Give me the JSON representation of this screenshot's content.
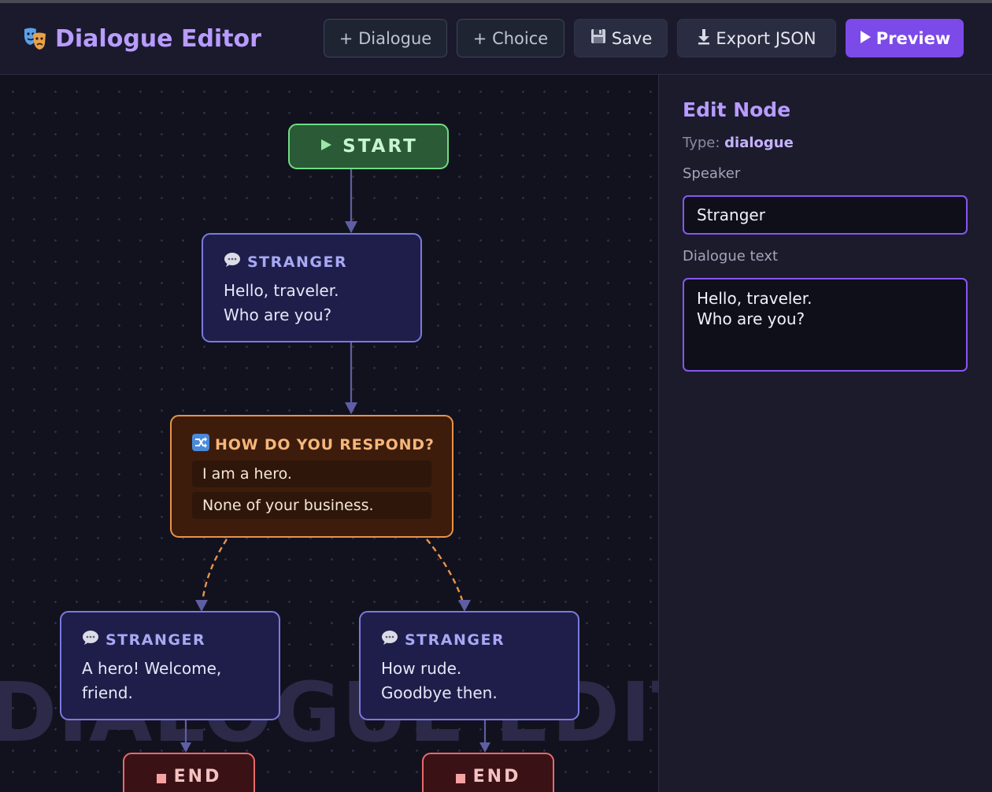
{
  "header": {
    "title": "Dialogue Editor",
    "buttons": {
      "add_dialogue": "+ Dialogue",
      "add_choice": "+ Choice",
      "save": "Save",
      "export": "Export JSON",
      "preview": "Preview"
    }
  },
  "canvas": {
    "watermark": "DIALOGUE EDITOR",
    "start_label": "START",
    "nodes": [
      {
        "speaker": "STRANGER",
        "lines": [
          "Hello, traveler.",
          "Who are you?"
        ]
      },
      {
        "speaker": "STRANGER",
        "lines": [
          "A hero! Welcome,",
          "friend."
        ]
      },
      {
        "speaker": "STRANGER",
        "lines": [
          "How rude.",
          "Goodbye then."
        ]
      }
    ],
    "choice": {
      "title": "HOW DO YOU RESPOND?",
      "options": [
        "I am a hero.",
        "None of your business."
      ]
    },
    "end_label": "END"
  },
  "panel": {
    "title": "Edit Node",
    "type_label": "Type:",
    "type_value": "dialogue",
    "speaker_label": "Speaker",
    "speaker_value": "Stranger",
    "text_label": "Dialogue text",
    "text_value": "Hello, traveler.\nWho are you?"
  },
  "colors": {
    "accent": "#7c4ae8",
    "start": "#6fdc82",
    "dialogue": "#7b79e0",
    "choice": "#e8944a",
    "end": "#e86a6a"
  }
}
